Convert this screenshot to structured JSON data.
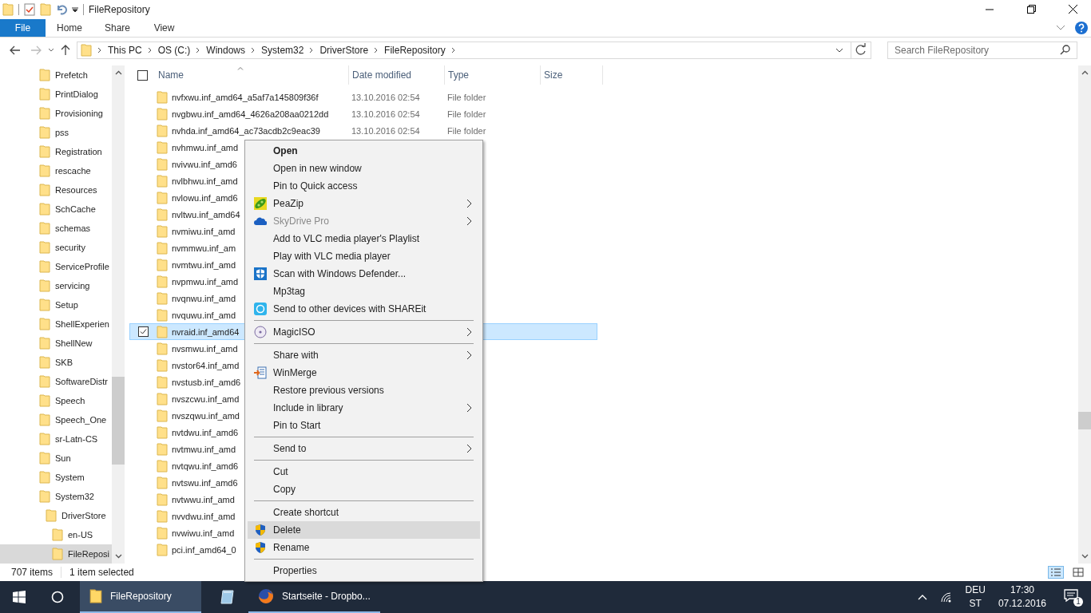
{
  "window": {
    "title": "FileRepository"
  },
  "ribbon": {
    "tabs": [
      {
        "label": "File",
        "selected": true
      },
      {
        "label": "Home",
        "selected": false
      },
      {
        "label": "Share",
        "selected": false
      },
      {
        "label": "View",
        "selected": false
      }
    ]
  },
  "address": {
    "path": [
      "This PC",
      "OS (C:)",
      "Windows",
      "System32",
      "DriverStore",
      "FileRepository"
    ]
  },
  "search": {
    "placeholder": "Search FileRepository"
  },
  "sidebar": {
    "items": [
      {
        "label": "Prefetch",
        "selected": false
      },
      {
        "label": "PrintDialog",
        "selected": false
      },
      {
        "label": "Provisioning",
        "selected": false
      },
      {
        "label": "pss",
        "selected": false
      },
      {
        "label": "Registration",
        "selected": false
      },
      {
        "label": "rescache",
        "selected": false
      },
      {
        "label": "Resources",
        "selected": false
      },
      {
        "label": "SchCache",
        "selected": false
      },
      {
        "label": "schemas",
        "selected": false
      },
      {
        "label": "security",
        "selected": false
      },
      {
        "label": "ServiceProfile",
        "selected": false
      },
      {
        "label": "servicing",
        "selected": false
      },
      {
        "label": "Setup",
        "selected": false
      },
      {
        "label": "ShellExperien",
        "selected": false
      },
      {
        "label": "ShellNew",
        "selected": false
      },
      {
        "label": "SKB",
        "selected": false
      },
      {
        "label": "SoftwareDistr",
        "selected": false
      },
      {
        "label": "Speech",
        "selected": false
      },
      {
        "label": "Speech_One",
        "selected": false
      },
      {
        "label": "sr-Latn-CS",
        "selected": false
      },
      {
        "label": "Sun",
        "selected": false
      },
      {
        "label": "System",
        "selected": false
      },
      {
        "label": "System32",
        "selected": false,
        "children": [
          {
            "label": "DriverStore",
            "selected": false,
            "children": [
              {
                "label": "en-US",
                "selected": false
              },
              {
                "label": "FileReposi",
                "selected": true
              }
            ]
          }
        ]
      }
    ]
  },
  "table": {
    "select_all": {
      "checked": false
    },
    "columns": [
      "Name",
      "Date modified",
      "Type",
      "Size"
    ],
    "rows": [
      {
        "name": "nvfxwu.inf_amd64_a5af7a145809f36f",
        "date": "13.10.2016 02:54",
        "type": "File folder",
        "selected": false
      },
      {
        "name": "nvgbwu.inf_amd64_4626a208aa0212dd",
        "date": "13.10.2016 02:54",
        "type": "File folder",
        "selected": false
      },
      {
        "name": "nvhda.inf_amd64_ac73acdb2c9eac39",
        "date": "13.10.2016 02:54",
        "type": "File folder",
        "selected": false
      },
      {
        "name": "nvhmwu.inf_amd",
        "selected": false
      },
      {
        "name": "nvivwu.inf_amd6",
        "selected": false
      },
      {
        "name": "nvlbhwu.inf_amd",
        "selected": false
      },
      {
        "name": "nvlowu.inf_amd6",
        "selected": false
      },
      {
        "name": "nvltwu.inf_amd64",
        "selected": false
      },
      {
        "name": "nvmiwu.inf_amd",
        "selected": false
      },
      {
        "name": "nvmmwu.inf_am",
        "selected": false
      },
      {
        "name": "nvmtwu.inf_amd",
        "selected": false
      },
      {
        "name": "nvpmwu.inf_amd",
        "selected": false
      },
      {
        "name": "nvqnwu.inf_amd",
        "selected": false
      },
      {
        "name": "nvquwu.inf_amd",
        "selected": false
      },
      {
        "name": "nvraid.inf_amd64",
        "selected": true
      },
      {
        "name": "nvsmwu.inf_amd",
        "selected": false
      },
      {
        "name": "nvstor64.inf_amd",
        "selected": false
      },
      {
        "name": "nvstusb.inf_amd6",
        "selected": false
      },
      {
        "name": "nvszcwu.inf_amd",
        "selected": false
      },
      {
        "name": "nvszqwu.inf_amd",
        "selected": false
      },
      {
        "name": "nvtdwu.inf_amd6",
        "selected": false
      },
      {
        "name": "nvtmwu.inf_amd",
        "selected": false
      },
      {
        "name": "nvtqwu.inf_amd6",
        "selected": false
      },
      {
        "name": "nvtswu.inf_amd6",
        "selected": false
      },
      {
        "name": "nvtwwu.inf_amd",
        "selected": false
      },
      {
        "name": "nvvdwu.inf_amd",
        "selected": false
      },
      {
        "name": "nvwiwu.inf_amd",
        "selected": false
      },
      {
        "name": "pci.inf_amd64_0",
        "selected": false
      }
    ]
  },
  "context_menu": {
    "groups": [
      [
        {
          "label": "Open",
          "default": true,
          "submenu": false,
          "disabled": false,
          "selected": false
        },
        {
          "label": "Open in new window",
          "default": false,
          "submenu": false,
          "disabled": false,
          "selected": false
        },
        {
          "label": "Pin to Quick access",
          "default": false,
          "submenu": false,
          "disabled": false,
          "selected": false
        },
        {
          "label": "PeaZip",
          "default": false,
          "submenu": true,
          "disabled": false,
          "selected": false
        },
        {
          "label": "SkyDrive Pro",
          "default": false,
          "submenu": true,
          "disabled": true,
          "selected": false
        },
        {
          "label": "Add to VLC media player's Playlist",
          "default": false,
          "submenu": false,
          "disabled": false,
          "selected": false
        },
        {
          "label": "Play with VLC media player",
          "default": false,
          "submenu": false,
          "disabled": false,
          "selected": false
        },
        {
          "label": "Scan with Windows Defender...",
          "default": false,
          "submenu": false,
          "disabled": false,
          "selected": false
        },
        {
          "label": "Mp3tag",
          "default": false,
          "submenu": false,
          "disabled": false,
          "selected": false
        },
        {
          "label": "Send to other devices with SHAREit",
          "default": false,
          "submenu": false,
          "disabled": false,
          "selected": false
        }
      ],
      [
        {
          "label": "MagicISO",
          "default": false,
          "submenu": true,
          "disabled": false,
          "selected": false
        }
      ],
      [
        {
          "label": "Share with",
          "default": false,
          "submenu": true,
          "disabled": false,
          "selected": false
        },
        {
          "label": "WinMerge",
          "default": false,
          "submenu": false,
          "disabled": false,
          "selected": false
        },
        {
          "label": "Restore previous versions",
          "default": false,
          "submenu": false,
          "disabled": false,
          "selected": false
        },
        {
          "label": "Include in library",
          "default": false,
          "submenu": true,
          "disabled": false,
          "selected": false
        },
        {
          "label": "Pin to Start",
          "default": false,
          "submenu": false,
          "disabled": false,
          "selected": false
        }
      ],
      [
        {
          "label": "Send to",
          "default": false,
          "submenu": true,
          "disabled": false,
          "selected": false
        }
      ],
      [
        {
          "label": "Cut",
          "default": false,
          "submenu": false,
          "disabled": false,
          "selected": false
        },
        {
          "label": "Copy",
          "default": false,
          "submenu": false,
          "disabled": false,
          "selected": false
        }
      ],
      [
        {
          "label": "Create shortcut",
          "default": false,
          "submenu": false,
          "disabled": false,
          "selected": false
        },
        {
          "label": "Delete",
          "default": false,
          "submenu": false,
          "disabled": false,
          "selected": true
        },
        {
          "label": "Rename",
          "default": false,
          "submenu": false,
          "disabled": false,
          "selected": false
        }
      ],
      [
        {
          "label": "Properties",
          "default": false,
          "submenu": false,
          "disabled": false,
          "selected": false
        }
      ]
    ]
  },
  "status_bar": {
    "item_count": "707 items",
    "selection": "1 item selected"
  },
  "taskbar": {
    "apps": [
      {
        "label": "FileRepository",
        "selected": true
      },
      {
        "label": "Startseite - Dropbo...",
        "selected": false
      }
    ],
    "language": [
      "DEU",
      "ST"
    ],
    "time": "17:30",
    "date": "07.12.2016",
    "notifications": "1"
  }
}
